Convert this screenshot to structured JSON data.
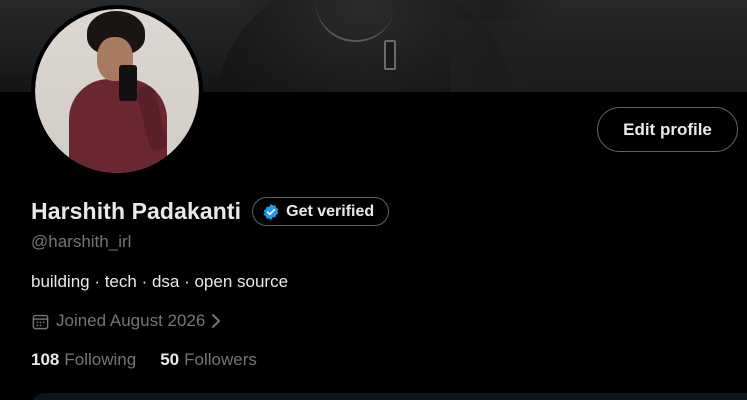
{
  "profile": {
    "display_name": "Harshith Padakanti",
    "handle": "@harshith_irl",
    "bio": "building · tech · dsa · open source",
    "joined": "Joined August 2026",
    "edit_label": "Edit profile",
    "verify_label": "Get verified"
  },
  "stats": {
    "following_count": "108",
    "following_label": "Following",
    "followers_count": "50",
    "followers_label": "Followers"
  },
  "icons": {
    "verified": "verified-badge-icon",
    "calendar": "calendar-icon",
    "chevron": "chevron-right-icon"
  },
  "colors": {
    "background": "#000000",
    "text_primary": "#e7e9ea",
    "text_secondary": "#71767b",
    "border": "#536471",
    "verified_blue": "#1d9bf0"
  }
}
